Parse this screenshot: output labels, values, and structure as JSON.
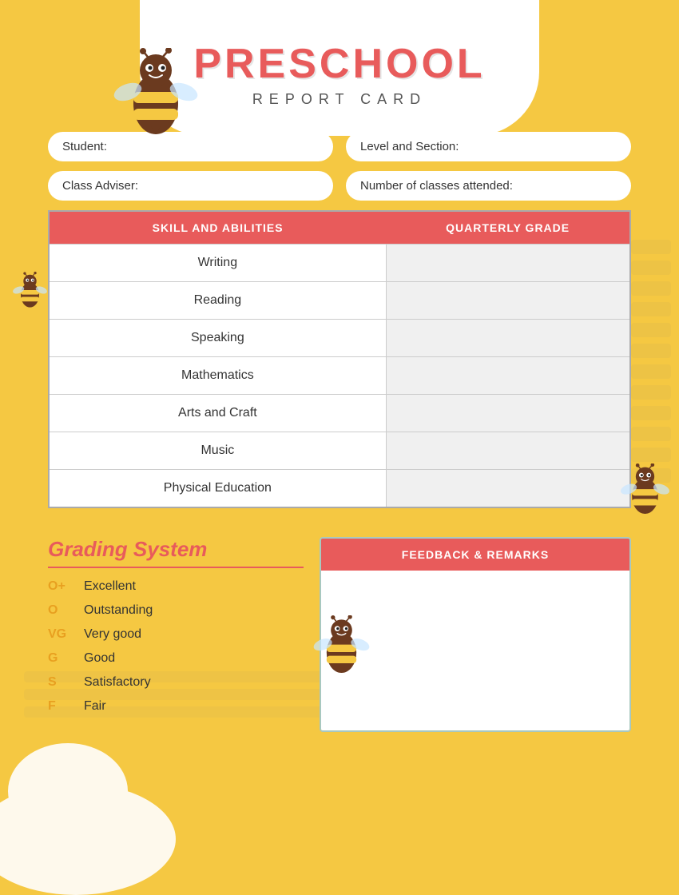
{
  "header": {
    "title_main": "PRESCHOOL",
    "title_sub": "REPORT CARD"
  },
  "form": {
    "student_label": "Student:",
    "level_label": "Level and Section:",
    "adviser_label": "Class Adviser:",
    "classes_label": "Number of classes attended:"
  },
  "table": {
    "col_skills": "SKILL AND ABILITIES",
    "col_grade": "QUARTERLY GRADE",
    "rows": [
      {
        "skill": "Writing",
        "grade": ""
      },
      {
        "skill": "Reading",
        "grade": ""
      },
      {
        "skill": "Speaking",
        "grade": ""
      },
      {
        "skill": "Mathematics",
        "grade": ""
      },
      {
        "skill": "Arts and Craft",
        "grade": ""
      },
      {
        "skill": "Music",
        "grade": ""
      },
      {
        "skill": "Physical Education",
        "grade": ""
      }
    ]
  },
  "grading": {
    "title": "Grading System",
    "items": [
      {
        "code": "O+",
        "description": "Excellent"
      },
      {
        "code": "O",
        "description": "Outstanding"
      },
      {
        "code": "VG",
        "description": "Very good"
      },
      {
        "code": "G",
        "description": "Good"
      },
      {
        "code": "S",
        "description": "Satisfactory"
      },
      {
        "code": "F",
        "description": "Fair"
      }
    ]
  },
  "feedback": {
    "header": "FEEDBACK & REMARKS"
  }
}
